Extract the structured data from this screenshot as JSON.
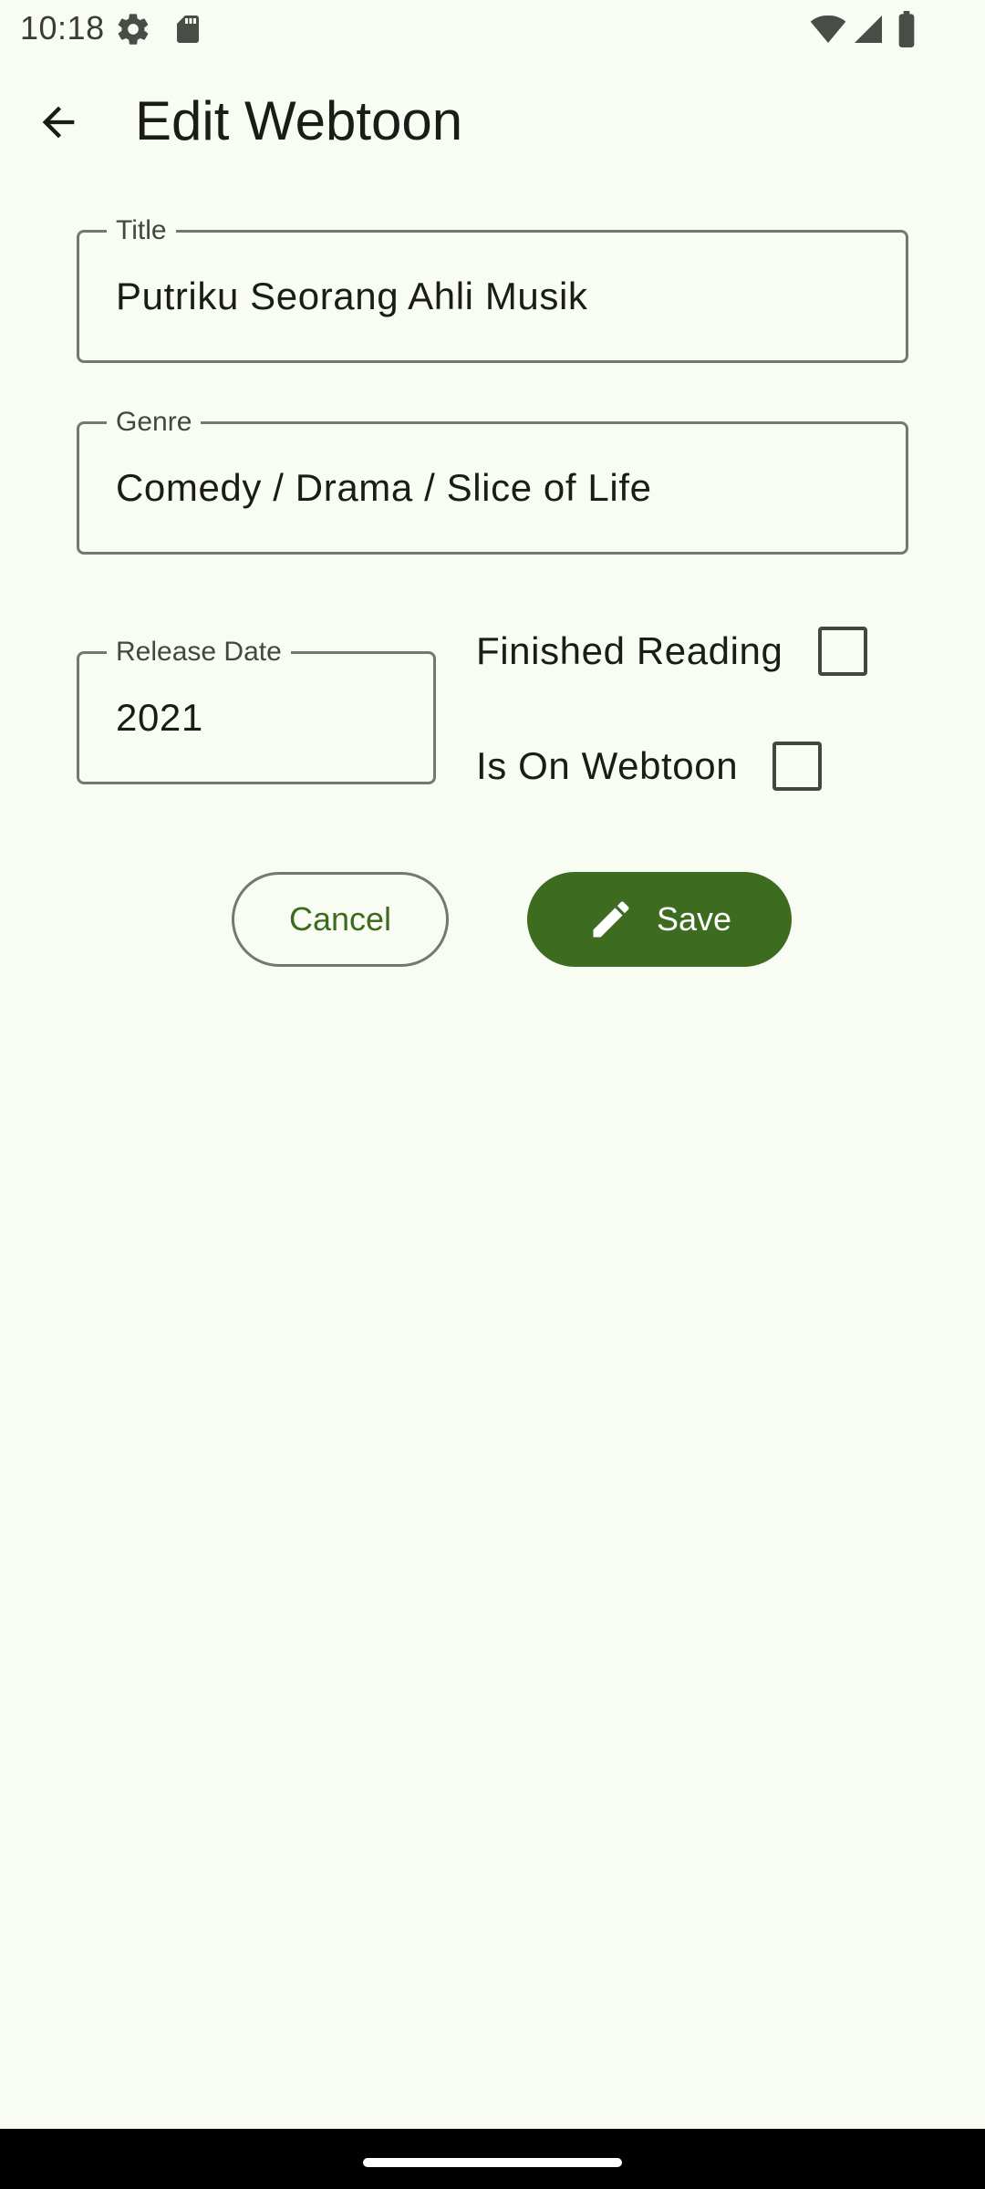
{
  "status_bar": {
    "time": "10:18",
    "icons": [
      "settings-icon",
      "sd-card-icon",
      "wifi-icon",
      "signal-icon",
      "battery-icon"
    ]
  },
  "app_bar": {
    "title": "Edit Webtoon",
    "back_icon": "arrow-back-icon"
  },
  "form": {
    "title_field": {
      "label": "Title",
      "value": "Putriku Seorang Ahli Musik"
    },
    "genre_field": {
      "label": "Genre",
      "value": "Comedy / Drama / Slice of Life"
    },
    "release_date_field": {
      "label": "Release Date",
      "value": "2021"
    },
    "finished_reading": {
      "label": "Finished Reading",
      "checked": false
    },
    "is_on_webtoon": {
      "label": "Is On Webtoon",
      "checked": false
    }
  },
  "actions": {
    "cancel_label": "Cancel",
    "save_label": "Save",
    "save_icon": "pencil-icon"
  },
  "colors": {
    "background": "#f9fcf2",
    "primary": "#3d6b20",
    "outline": "#74796d",
    "on_surface": "#1a1c18"
  }
}
